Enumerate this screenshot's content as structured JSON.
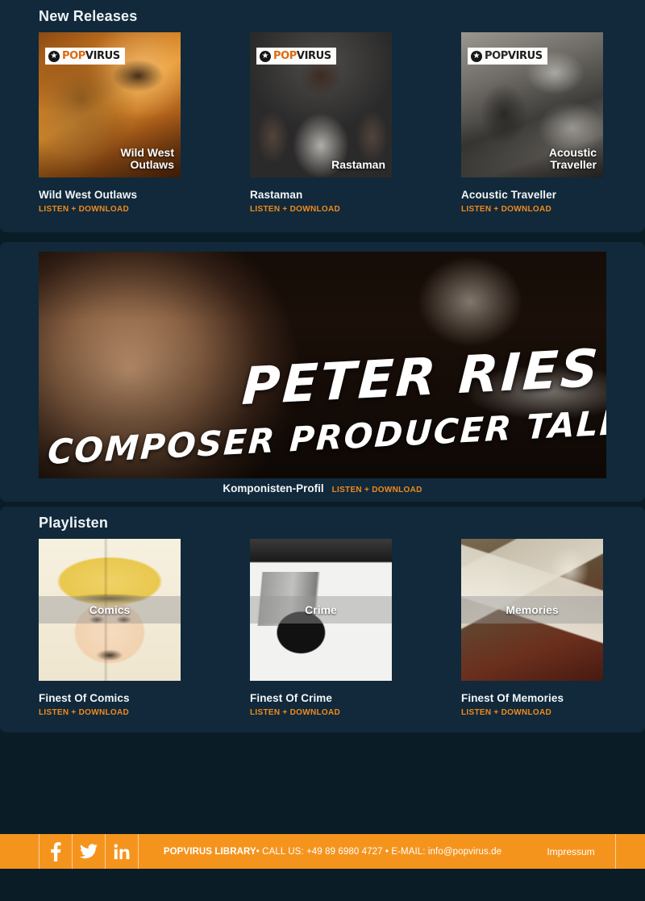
{
  "sections": {
    "new_releases_title": "New Releases",
    "playlists_title": "Playlisten"
  },
  "labels": {
    "listen_download": "LISTEN + DOWNLOAD"
  },
  "colors": {
    "accent_orange": "#f08a1e",
    "footer_orange": "#f5941d",
    "panel_bg": "#11293a",
    "page_bg": "#0a1d26"
  },
  "new_releases": [
    {
      "title": "Wild West Outlaws",
      "art_caption_line1": "Wild West",
      "art_caption_line2": "Outlaws",
      "badge": {
        "pop": "POP",
        "virus": "VIRUS",
        "star": "star-icon"
      },
      "link": "LISTEN + DOWNLOAD"
    },
    {
      "title": "Rastaman",
      "art_caption_line1": "Rastaman",
      "art_caption_line2": "",
      "badge": {
        "pop": "POP",
        "virus": "VIRUS",
        "star": "star-icon"
      },
      "link": "LISTEN + DOWNLOAD"
    },
    {
      "title": "Acoustic Traveller",
      "art_caption_line1": "Acoustic",
      "art_caption_line2": "Traveller",
      "badge": {
        "pop": "POP",
        "virus": "VIRUS",
        "star": "star-icon"
      },
      "link": "LISTEN + DOWNLOAD"
    }
  ],
  "feature": {
    "name": "PETER RIES",
    "subtitle": "COMPOSER PRODUCER TALENT",
    "caption": "Komponisten-Profil",
    "link": "LISTEN + DOWNLOAD"
  },
  "playlists": [
    {
      "title": "Finest Of Comics",
      "overlay": "Comics",
      "link": "LISTEN + DOWNLOAD"
    },
    {
      "title": "Finest Of Crime",
      "overlay": "Crime",
      "link": "LISTEN + DOWNLOAD"
    },
    {
      "title": "Finest Of Memories",
      "overlay": "Memories",
      "link": "LISTEN + DOWNLOAD"
    }
  ],
  "footer": {
    "social": [
      {
        "name": "facebook-icon",
        "glyph": "f"
      },
      {
        "name": "twitter-icon",
        "glyph": "t"
      },
      {
        "name": "linkedin-icon",
        "glyph": "in"
      }
    ],
    "brand": "POPVIRUS LIBRARY",
    "contact": " • CALL US: +49 89 6980 4727 • E-MAIL: info@popvirus.de",
    "impressum": "Impressum"
  }
}
